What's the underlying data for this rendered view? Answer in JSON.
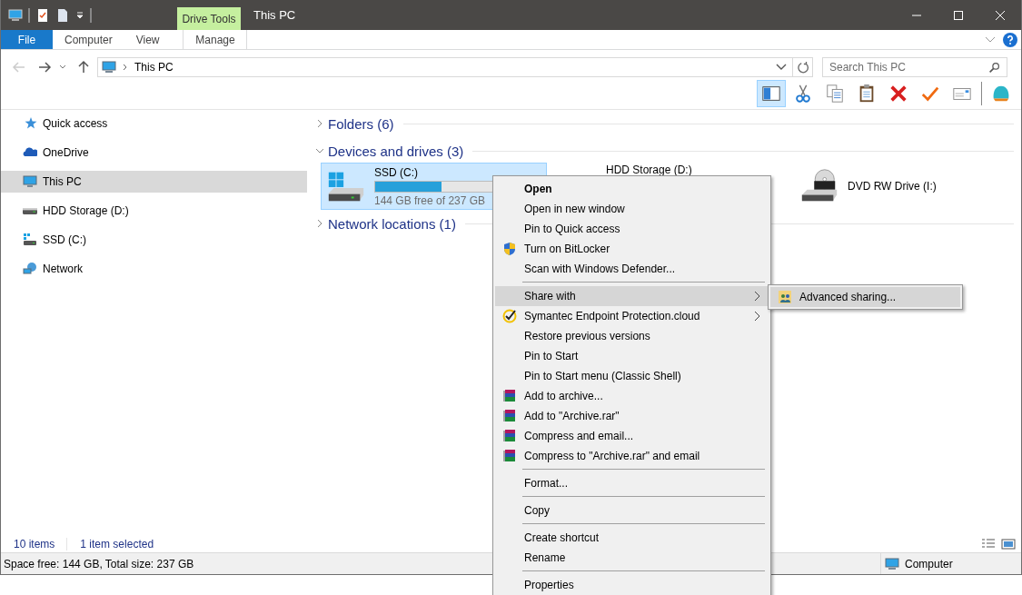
{
  "title_bar": {
    "title": "This PC",
    "context_tab": "Drive Tools"
  },
  "ribbon_tabs": [
    {
      "label": "File",
      "kind": "file",
      "selected": false
    },
    {
      "label": "Computer",
      "kind": "plain",
      "selected": false
    },
    {
      "label": "View",
      "kind": "plain",
      "selected": false
    },
    {
      "label": "Manage",
      "kind": "contextual",
      "selected": false
    }
  ],
  "address_bar": {
    "path": "This PC"
  },
  "search": {
    "placeholder": "Search This PC"
  },
  "toolbar": [
    {
      "kind": "pane",
      "on": true
    },
    {
      "kind": "cut"
    },
    {
      "kind": "copy"
    },
    {
      "kind": "paste"
    },
    {
      "kind": "delete"
    },
    {
      "kind": "check"
    },
    {
      "kind": "mail"
    },
    {
      "kind": "shell"
    }
  ],
  "sidebar": {
    "items": [
      {
        "label": "Quick access",
        "kind": "star",
        "selected": false
      },
      {
        "label": "OneDrive",
        "kind": "cloud",
        "selected": false
      },
      {
        "label": "This PC",
        "kind": "pc",
        "selected": true
      },
      {
        "label": "HDD Storage (D:)",
        "kind": "hdd",
        "selected": false
      },
      {
        "label": "SSD (C:)",
        "kind": "ssd",
        "selected": false
      },
      {
        "label": "Network",
        "kind": "network",
        "selected": false
      }
    ]
  },
  "groups": [
    {
      "title": "Folders (6)",
      "expanded": false
    },
    {
      "title": "Devices and drives (3)",
      "expanded": true
    },
    {
      "title": "Network locations (1)",
      "expanded": false
    }
  ],
  "drives": [
    {
      "name": "SSD (C:)",
      "kind": "ssd",
      "selected": true,
      "level": 0.39,
      "free_text": "144 GB free of 237 GB"
    },
    {
      "name": "HDD Storage (D:)",
      "kind": "hidden",
      "selected": false
    },
    {
      "name": "DVD RW Drive (I:)",
      "kind": "dvd",
      "selected": false
    }
  ],
  "context_menu": {
    "items": [
      {
        "kind": "item",
        "label": "Open",
        "bold": true
      },
      {
        "kind": "item",
        "label": "Open in new window"
      },
      {
        "kind": "item",
        "label": "Pin to Quick access"
      },
      {
        "kind": "shield",
        "label": "Turn on BitLocker"
      },
      {
        "kind": "item",
        "label": "Scan with Windows Defender..."
      },
      {
        "kind": "separator"
      },
      {
        "kind": "item",
        "label": "Share with",
        "submenu": true,
        "selected": true
      },
      {
        "kind": "antivirus",
        "label": "Symantec Endpoint Protection.cloud",
        "submenu": true
      },
      {
        "kind": "item",
        "label": "Restore previous versions"
      },
      {
        "kind": "item",
        "label": "Pin to Start"
      },
      {
        "kind": "item",
        "label": "Pin to Start menu (Classic Shell)"
      },
      {
        "kind": "archive",
        "label": "Add to archive..."
      },
      {
        "kind": "archive",
        "label": "Add to \"Archive.rar\""
      },
      {
        "kind": "archive",
        "label": "Compress and email..."
      },
      {
        "kind": "archive",
        "label": "Compress to \"Archive.rar\" and email"
      },
      {
        "kind": "separator"
      },
      {
        "kind": "item",
        "label": "Format..."
      },
      {
        "kind": "separator"
      },
      {
        "kind": "item",
        "label": "Copy"
      },
      {
        "kind": "separator"
      },
      {
        "kind": "item",
        "label": "Create shortcut"
      },
      {
        "kind": "item",
        "label": "Rename"
      },
      {
        "kind": "separator"
      },
      {
        "kind": "item",
        "label": "Properties"
      }
    ]
  },
  "submenu": {
    "items": [
      {
        "label": "Advanced sharing...",
        "kind": "sharing",
        "selected": true
      }
    ]
  },
  "status_row": {
    "item_count": "10 items",
    "selection": "1 item selected"
  },
  "details_bar": {
    "space": "Space free: 144 GB, Total size: 237 GB",
    "location": "Computer"
  }
}
